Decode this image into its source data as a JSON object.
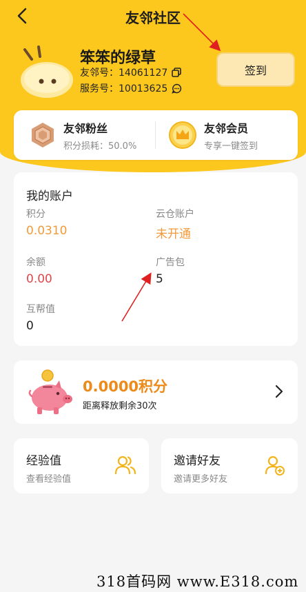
{
  "header": {
    "title": "友邻社区"
  },
  "profile": {
    "name": "笨笨的绿草",
    "neighbor_id": "友邻号：14061127",
    "service_id": "服务号：10013625",
    "sign_label": "签到"
  },
  "membership": {
    "fans": {
      "title": "友邻粉丝",
      "sub": "积分损耗：50.0%"
    },
    "vip": {
      "title": "友邻会员",
      "sub": "专享一键签到"
    }
  },
  "account": {
    "title": "我的账户",
    "points": {
      "label": "积分",
      "value": "0.0310"
    },
    "cloud": {
      "label": "云仓账户",
      "value": "未开通"
    },
    "balance": {
      "label": "余额",
      "value": "0.00"
    },
    "ad_pack": {
      "label": "广告包",
      "value": "5"
    },
    "mutual": {
      "label": "互帮值",
      "value": "0"
    }
  },
  "release": {
    "points": "0.0000积分",
    "sub": "距离释放剩余30次"
  },
  "cards": {
    "exp": {
      "title": "经验值",
      "sub": "查看经验值"
    },
    "invite": {
      "title": "邀请好友",
      "sub": "邀请更多好友"
    }
  },
  "watermark": "318首码网 www.E318.com",
  "colors": {
    "brand": "#fcc81e",
    "orange": "#f29a3a",
    "red": "#e0464a",
    "annotation": "#e02020"
  }
}
